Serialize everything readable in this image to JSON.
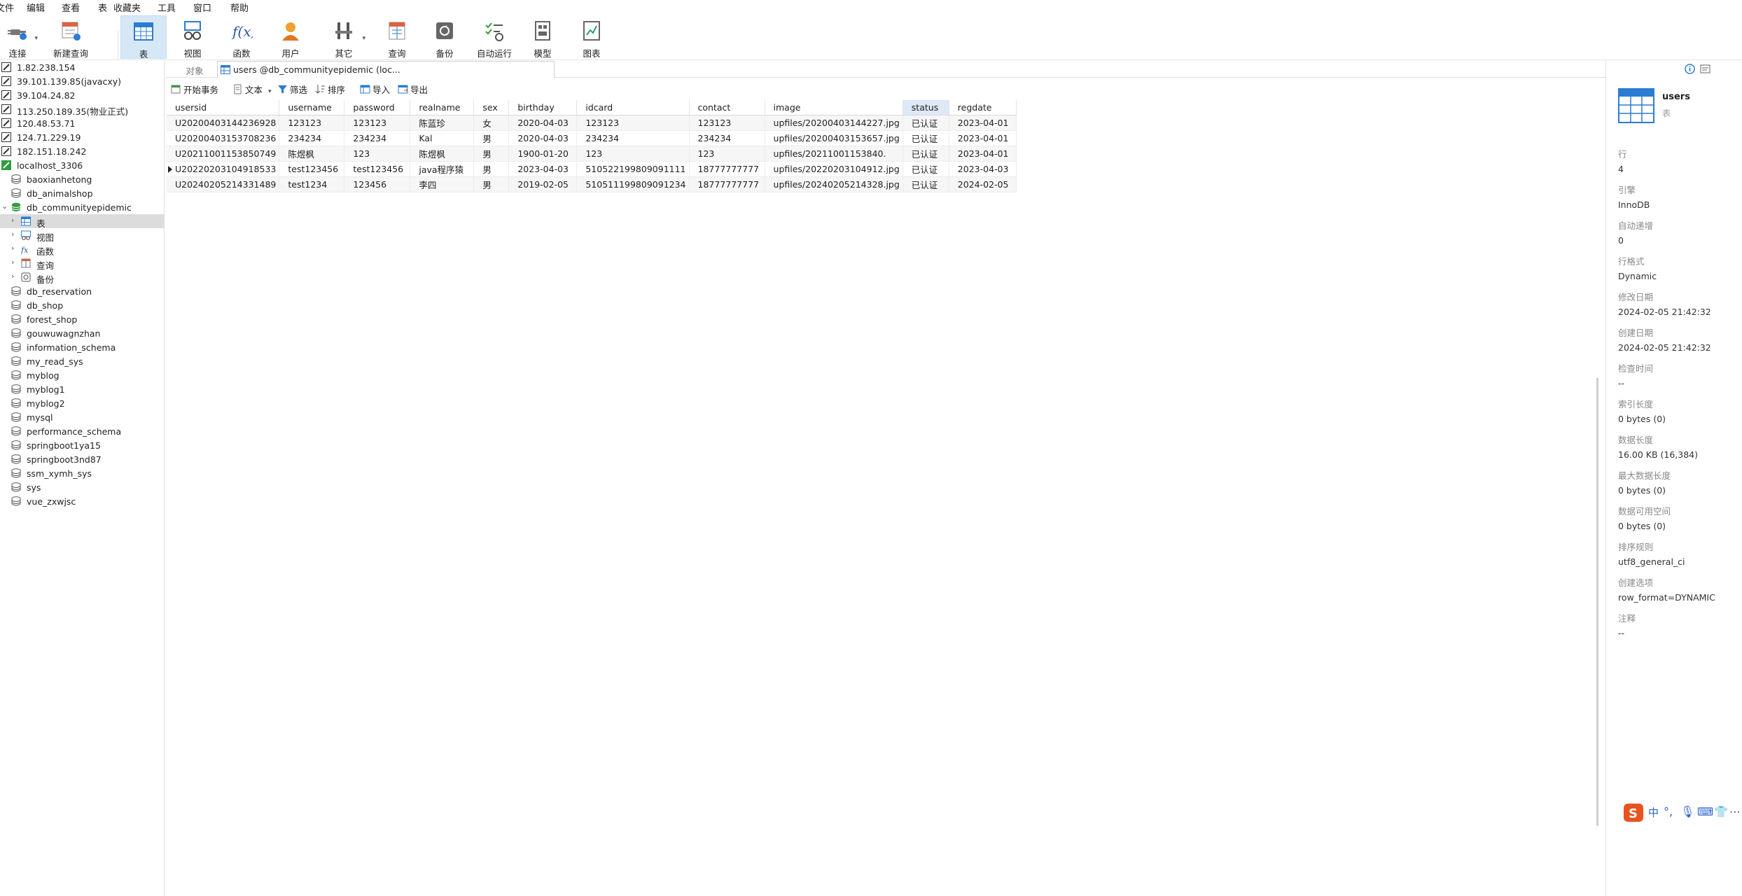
{
  "menu": [
    "文件",
    "编辑",
    "查看",
    "表",
    "收藏夹",
    "工具",
    "窗口",
    "帮助"
  ],
  "toolbar": {
    "connect": "连接",
    "new_query": "新建查询",
    "table": "表",
    "view": "视图",
    "function": "函数",
    "user": "用户",
    "other": "其它",
    "query": "查询",
    "backup": "备份",
    "auto_run": "自动运行",
    "model": "模型",
    "chart": "图表"
  },
  "sidebar": {
    "connections": [
      "1.82.238.154",
      "39.101.139.85(javacxy)",
      "39.104.24.82",
      "113.250.189.35(物业正式)",
      "120.48.53.71",
      "124.71.229.19",
      "182.151.18.242",
      "localhost_3306"
    ],
    "databases_before": [
      "baoxianhetong",
      "db_animalshop",
      "db_communityepidemic"
    ],
    "children": [
      "表",
      "视图",
      "函数",
      "查询",
      "备份"
    ],
    "databases_after": [
      "db_reservation",
      "db_shop",
      "forest_shop",
      "gouwuwagnzhan",
      "information_schema",
      "my_read_sys",
      "myblog",
      "myblog1",
      "myblog2",
      "mysql",
      "performance_schema",
      "springboot1ya15",
      "springboot3nd87",
      "ssm_xymh_sys",
      "sys",
      "vue_zxwjsc"
    ]
  },
  "tabs": {
    "objects": "对象",
    "active": "users @db_communityepidemic (loc..."
  },
  "subbar": {
    "begin_tx": "开始事务",
    "text": "文本",
    "filter": "筛选",
    "sort": "排序",
    "import": "导入",
    "export": "导出"
  },
  "grid": {
    "columns": [
      "usersid",
      "username",
      "password",
      "realname",
      "sex",
      "birthday",
      "idcard",
      "contact",
      "image",
      "status",
      "regdate"
    ],
    "rows": [
      [
        "U20200403144236928",
        "123123",
        "123123",
        "陈蓝珍",
        "女",
        "2020-04-03",
        "123123",
        "123123",
        "upfiles/20200403144227.jpg",
        "已认证",
        "2023-04-01"
      ],
      [
        "U20200403153708236",
        "234234",
        "234234",
        "Kal",
        "男",
        "2020-04-03",
        "234234",
        "234234",
        "upfiles/20200403153657.jpg",
        "已认证",
        "2023-04-01"
      ],
      [
        "U20211001153850749",
        "陈煜枫",
        "123",
        "陈煜枫",
        "男",
        "1900-01-20",
        "123",
        "123",
        "upfiles/20211001153840.",
        "已认证",
        "2023-04-01"
      ],
      [
        "U20220203104918533",
        "test123456",
        "test123456",
        "java程序猿",
        "男",
        "2023-04-03",
        "510522199809091111",
        "18777777777",
        "upfiles/20220203104912.jpg",
        "已认证",
        "2023-04-03"
      ],
      [
        "U20240205214331489",
        "test1234",
        "123456",
        "李四",
        "男",
        "2019-02-05",
        "510511199809091234",
        "18777777777",
        "upfiles/20240205214328.jpg",
        "已认证",
        "2024-02-05"
      ]
    ]
  },
  "info": {
    "name": "users",
    "type": "表",
    "props": [
      {
        "k": "行",
        "v": "4"
      },
      {
        "k": "引擎",
        "v": "InnoDB"
      },
      {
        "k": "自动递增",
        "v": "0"
      },
      {
        "k": "行格式",
        "v": "Dynamic"
      },
      {
        "k": "修改日期",
        "v": "2024-02-05 21:42:32"
      },
      {
        "k": "创建日期",
        "v": "2024-02-05 21:42:32"
      },
      {
        "k": "检查时间",
        "v": "--"
      },
      {
        "k": "索引长度",
        "v": "0 bytes (0)"
      },
      {
        "k": "数据长度",
        "v": "16.00 KB (16,384)"
      },
      {
        "k": "最大数据长度",
        "v": "0 bytes (0)"
      },
      {
        "k": "数据可用空间",
        "v": "0 bytes (0)"
      },
      {
        "k": "排序规则",
        "v": "utf8_general_ci"
      },
      {
        "k": "创建选项",
        "v": "row_format=DYNAMIC"
      },
      {
        "k": "注释",
        "v": "--"
      }
    ]
  },
  "ime": {
    "lang": "中"
  },
  "colors": {
    "accent": "#2b7cd3",
    "selected": "#dcdcdc",
    "active_tool": "#d6e8f7",
    "db_green": "#2e9e3e"
  }
}
